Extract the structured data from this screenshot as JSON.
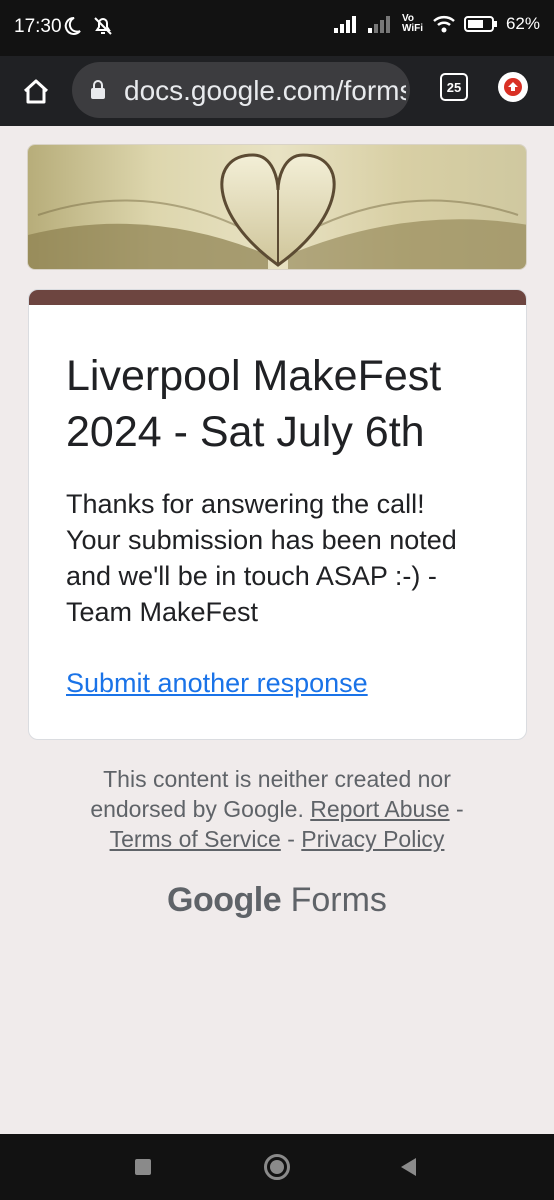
{
  "status_bar": {
    "time": "17:30",
    "wifi_label": "Vo WiFi",
    "battery": "62%"
  },
  "browser": {
    "url": "docs.google.com/forms",
    "tab_count": "25"
  },
  "form": {
    "title": "Liverpool MakeFest 2024 - Sat July 6th",
    "confirmation": "Thanks for answering the call! Your submission has been noted and we'll be in touch ASAP :-) - Team MakeFest",
    "submit_another": "Submit another response",
    "accent_color": "#6d4540"
  },
  "footer": {
    "disclaimer": "This content is neither created nor endorsed by Google.",
    "report_abuse": "Report Abuse",
    "terms": "Terms of Service",
    "privacy": "Privacy Policy",
    "brand_google": "Google",
    "brand_forms": "Forms"
  }
}
